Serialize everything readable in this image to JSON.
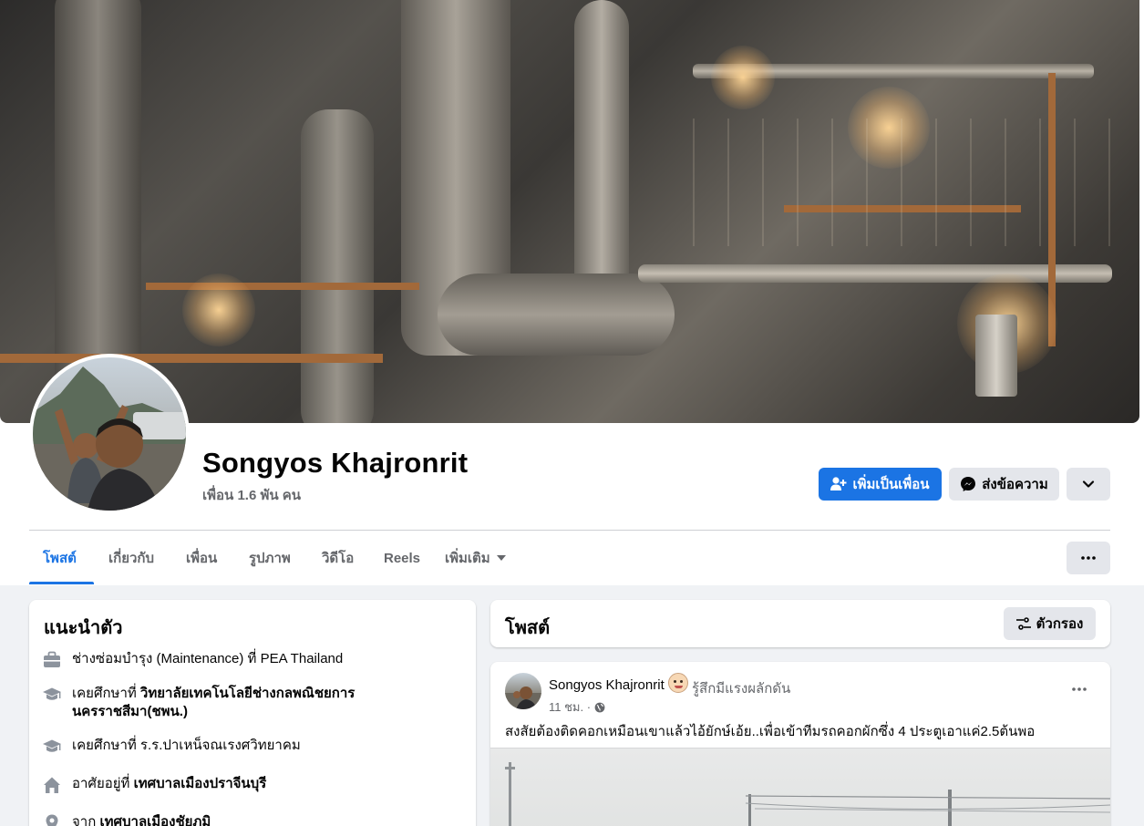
{
  "profile": {
    "name": "Songyos Khajronrit",
    "friends": "เพื่อน 1.6 พัน คน"
  },
  "actions": {
    "add_friend": "เพิ่มเป็นเพื่อน",
    "message": "ส่งข้อความ"
  },
  "tabs": [
    {
      "label": "โพสต์",
      "active": true
    },
    {
      "label": "เกี่ยวกับ"
    },
    {
      "label": "เพื่อน"
    },
    {
      "label": "รูปภาพ"
    },
    {
      "label": "วิดีโอ"
    },
    {
      "label": "Reels"
    },
    {
      "label": "เพิ่มเติม"
    }
  ],
  "intro": {
    "title": "แนะนำตัว",
    "work": "ช่างซ่อมบำรุง (Maintenance) ที่ PEA Thailand",
    "edu1_prefix": "เคยศึกษาที่ ",
    "edu1_place_line1": "วิทยาลัยเทคโนโลยีช่างกลพณิชยการ",
    "edu1_place_line2": "นครราชสีมา(ชพน.)",
    "edu2": "เคยศึกษาที่ ร.ร.ปาเหน็จณเรงศวิทยาคม",
    "lives_prefix": "อาศัยอยู่ที่ ",
    "lives_place": "เทศบาลเมืองปราจีนบุรี",
    "from_prefix": "จาก ",
    "from_place": "เทศบาลเมืองชัยภูมิ"
  },
  "posts_header": {
    "title": "โพสต์",
    "filter": "ตัวกรอง"
  },
  "post": {
    "author": "Songyos Khajronrit",
    "feeling": "รู้สึกมีแรงผลักดัน",
    "time": "11 ชม. ·",
    "text": "สงสัยต้องติดคอกเหมือนเขาแล้วไอ้ยักษ์เอ้ย..เพื่อเข้าทีมรถคอกผักซึ่ง 4 ประตูเอาแค่2.5ต้นพอ"
  },
  "icons": {
    "add_friend": "add-person-icon",
    "message": "messenger-icon",
    "more": "chevron-down-icon",
    "tab_more": "ellipsis-icon",
    "work": "briefcase-icon",
    "education": "graduation-cap-icon",
    "home": "home-icon",
    "location": "location-pin-icon",
    "filter": "filter-icon",
    "globe": "globe-icon"
  },
  "colors": {
    "accent": "#1b74e4",
    "background": "#f0f2f5",
    "secondary_text": "#65676b",
    "secondary_button": "#e4e6eb"
  }
}
